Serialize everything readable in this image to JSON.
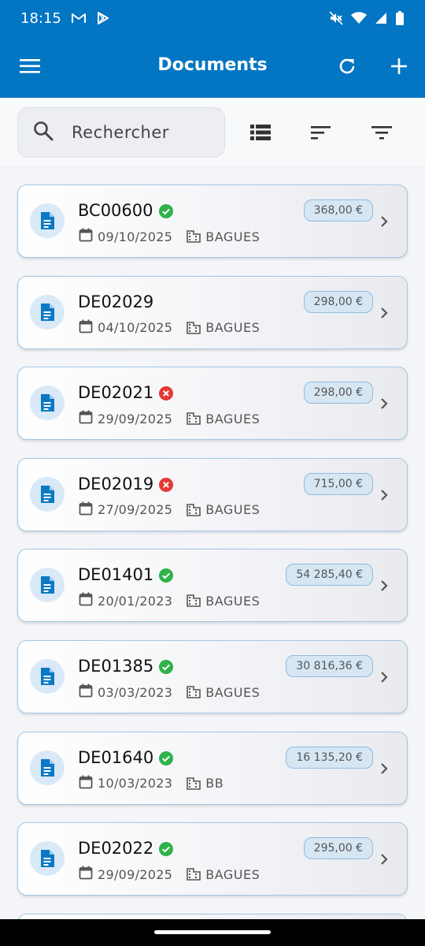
{
  "status_bar": {
    "time": "18:15"
  },
  "app_bar": {
    "title": "Documents"
  },
  "search": {
    "placeholder": "Rechercher"
  },
  "documents": [
    {
      "code": "BC00600",
      "status": "validated",
      "date": "09/10/2025",
      "entity": "BAGUES",
      "amount": "368,00 €"
    },
    {
      "code": "DE02029",
      "status": "none",
      "date": "04/10/2025",
      "entity": "BAGUES",
      "amount": "298,00 €"
    },
    {
      "code": "DE02021",
      "status": "rejected",
      "date": "29/09/2025",
      "entity": "BAGUES",
      "amount": "298,00 €"
    },
    {
      "code": "DE02019",
      "status": "rejected",
      "date": "27/09/2025",
      "entity": "BAGUES",
      "amount": "715,00 €"
    },
    {
      "code": "DE01401",
      "status": "validated",
      "date": "20/01/2023",
      "entity": "BAGUES",
      "amount": "54 285,40 €"
    },
    {
      "code": "DE01385",
      "status": "validated",
      "date": "03/03/2023",
      "entity": "BAGUES",
      "amount": "30 816,36 €"
    },
    {
      "code": "DE01640",
      "status": "validated",
      "date": "10/03/2023",
      "entity": "BB",
      "amount": "16 135,20 €"
    },
    {
      "code": "DE02022",
      "status": "validated",
      "date": "29/09/2025",
      "entity": "BAGUES",
      "amount": "295,00 €"
    },
    {
      "code": "",
      "status": "none",
      "date": "",
      "entity": "",
      "amount": ""
    }
  ],
  "colors": {
    "primary": "#0275c3",
    "validated": "#2fb24c",
    "rejected": "#e53935",
    "doc_icon": "#0b79c4"
  },
  "icons": {
    "status_bar": [
      "gmail-icon",
      "play-store-icon",
      "mute-icon",
      "wifi-icon",
      "signal-icon",
      "battery-icon"
    ],
    "app_bar": [
      "menu-icon",
      "refresh-icon",
      "add-icon"
    ],
    "toolbar": [
      "search-icon",
      "list-view-icon",
      "sort-icon",
      "filter-icon"
    ],
    "card": [
      "document-icon",
      "calendar-icon",
      "building-icon",
      "chevron-right-icon"
    ]
  }
}
